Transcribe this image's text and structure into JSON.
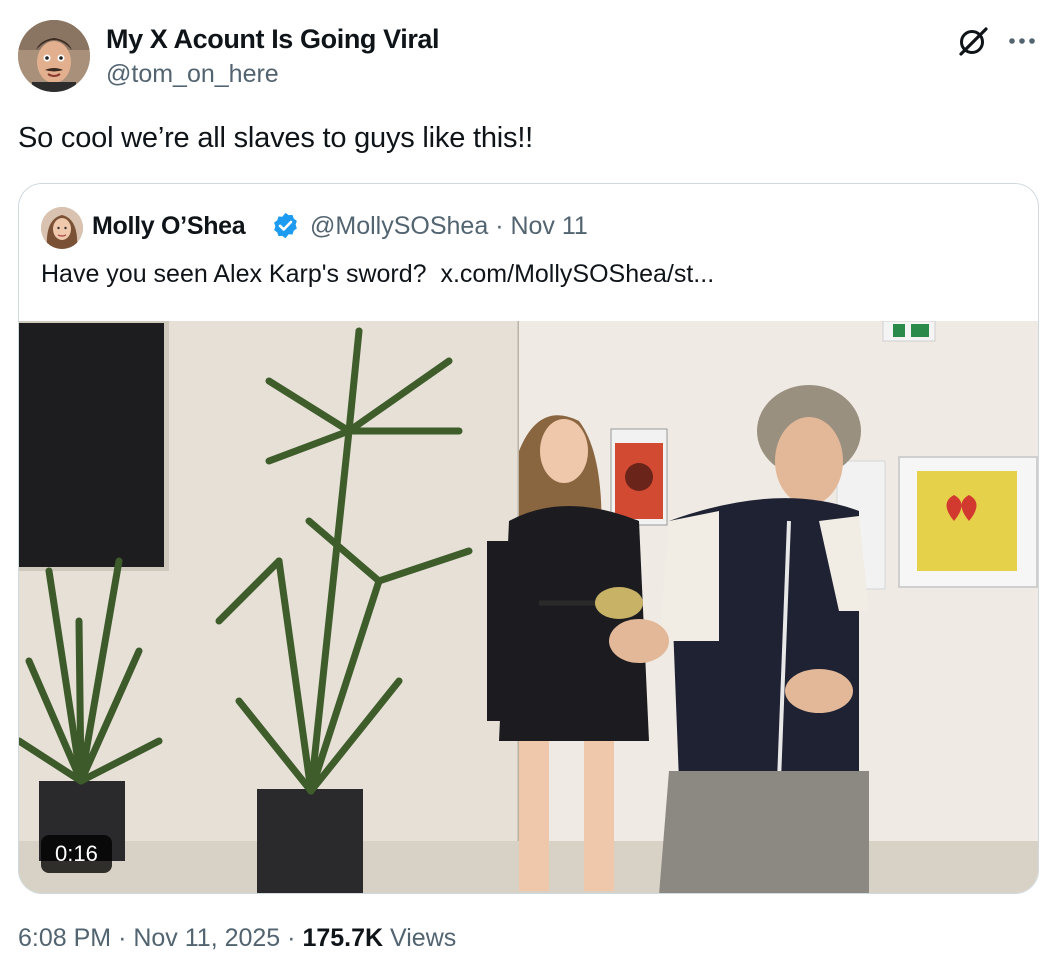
{
  "tweet": {
    "author_name": "My X Acount Is Going Viral",
    "author_handle": "@tom_on_here",
    "text": "So cool we’re all slaves to guys like this!!",
    "icons": {
      "grok": "grok-icon",
      "more": "more-icon"
    }
  },
  "quote": {
    "author_name": "Molly O’Shea",
    "verified": true,
    "author_handle": "@MollySOShea",
    "separator": "·",
    "date": "Nov 11",
    "text": "Have you seen Alex Karp's sword?",
    "link": "x.com/MollySOShea/st...",
    "video": {
      "duration": "0:16"
    }
  },
  "footer": {
    "time": "6:08 PM",
    "separator": "·",
    "date": "Nov 11, 2025",
    "views_count": "175.7K",
    "views_label": "Views"
  },
  "colors": {
    "text_primary": "#0f1419",
    "text_secondary": "#536471",
    "border": "#cfd9de",
    "verified_blue": "#1d9bf0"
  }
}
